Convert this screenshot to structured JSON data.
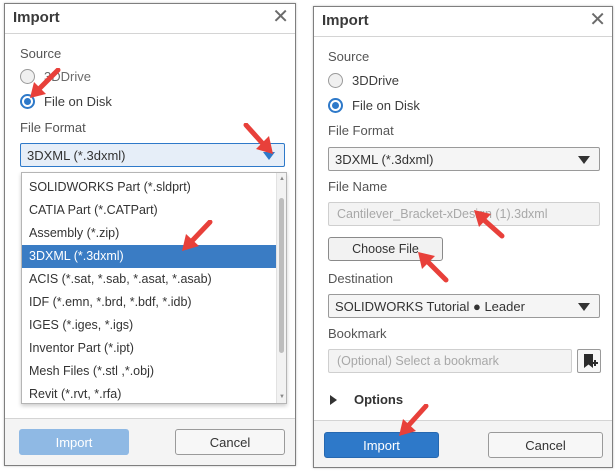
{
  "left_dialog": {
    "title": "Import",
    "source_label": "Source",
    "source_options": [
      {
        "label": "3DDrive",
        "selected": false
      },
      {
        "label": "File on Disk",
        "selected": true
      }
    ],
    "file_format_label": "File Format",
    "file_format_value": "3DXML (*.3dxml)",
    "format_options": [
      "SOLIDWORKS Part (*.sldprt)",
      "CATIA Part (*.CATPart)",
      "Assembly (*.zip)",
      "3DXML (*.3dxml)",
      "ACIS (*.sat, *.sab, *.asat, *.asab)",
      "IDF (*.emn, *.brd, *.bdf, *.idb)",
      "IGES (*.iges, *.igs)",
      "Inventor Part (*.ipt)",
      "Mesh Files (*.stl ,*.obj)",
      "Revit (*.rvt, *.rfa)"
    ],
    "selected_format_index": 3,
    "import_label": "Import",
    "cancel_label": "Cancel"
  },
  "right_dialog": {
    "title": "Import",
    "source_label": "Source",
    "source_options": [
      {
        "label": "3DDrive",
        "selected": false
      },
      {
        "label": "File on Disk",
        "selected": true
      }
    ],
    "file_format_label": "File Format",
    "file_format_value": "3DXML (*.3dxml)",
    "file_name_label": "File Name",
    "file_name_value": "Cantilever_Bracket-xDesign (1).3dxml",
    "choose_file_label": "Choose File",
    "destination_label": "Destination",
    "destination_value": "SOLIDWORKS Tutorial ● Leader",
    "bookmark_label": "Bookmark",
    "bookmark_placeholder": "(Optional) Select a bookmark",
    "options_label": "Options",
    "import_label": "Import",
    "cancel_label": "Cancel"
  },
  "colors": {
    "accent": "#2e79c9",
    "selection": "#3a7cc4",
    "annotation_arrow": "#e8403a"
  },
  "icons": {
    "close": "close-icon",
    "dropdown": "triangle-down-icon",
    "bookmark": "bookmark-add-icon",
    "options": "triangle-right-icon",
    "annotation": "red-arrow-icon"
  }
}
